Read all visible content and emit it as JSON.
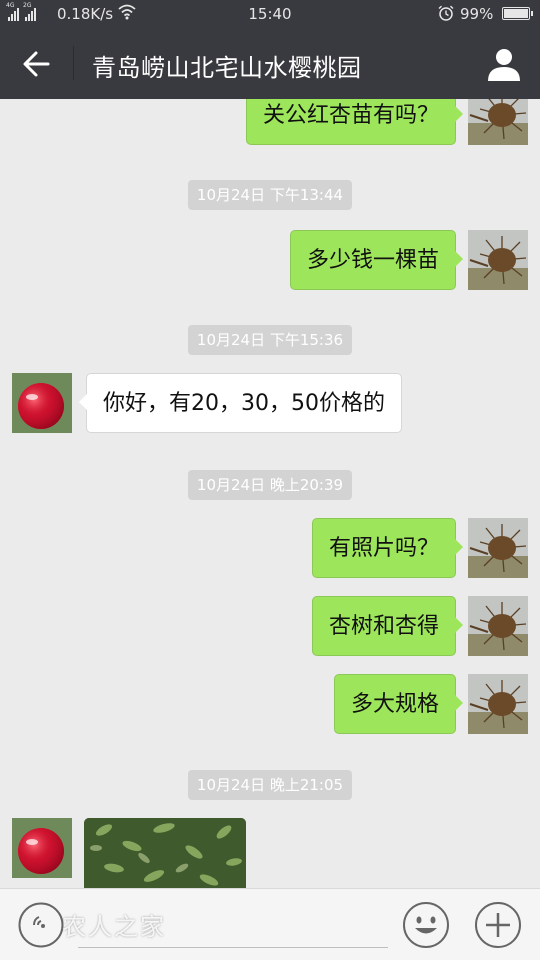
{
  "status_bar": {
    "signal1_label": "4G",
    "signal2_label": "2G",
    "network_speed": "0.18K/s",
    "clock": "15:40",
    "battery_percent": "99%",
    "battery_level": 0.99
  },
  "header": {
    "back_icon": "arrow-left-icon",
    "title": "青岛崂山北宅山水樱桃园",
    "profile_icon": "person-icon"
  },
  "messages": [
    {
      "type": "bubble",
      "side": "right",
      "text": "关公红杏苗有吗？"
    },
    {
      "type": "time",
      "text": "10月24日 下午13:44"
    },
    {
      "type": "bubble",
      "side": "right",
      "text": "多少钱一棵苗"
    },
    {
      "type": "time",
      "text": "10月24日 下午15:36"
    },
    {
      "type": "bubble",
      "side": "left",
      "text": "你好，有20，30，50价格的"
    },
    {
      "type": "time",
      "text": "10月24日 晚上20:39"
    },
    {
      "type": "bubble",
      "side": "right",
      "text": "有照片吗？"
    },
    {
      "type": "bubble",
      "side": "right",
      "text": "杏树和杏得"
    },
    {
      "type": "bubble",
      "side": "right",
      "text": "多大规格"
    },
    {
      "type": "time",
      "text": "10月24日 晚上21:05"
    },
    {
      "type": "image",
      "side": "left"
    }
  ],
  "input_bar": {
    "voice_icon": "voice-icon",
    "watermark": "农人之家",
    "emoji_icon": "smiley-icon",
    "more_icon": "plus-icon"
  },
  "colors": {
    "header_bg": "#393a3f",
    "chat_bg": "#ebebeb",
    "outgoing_bubble": "#9de55a",
    "incoming_bubble": "#ffffff",
    "timestamp_bg": "#d3d3d3"
  }
}
